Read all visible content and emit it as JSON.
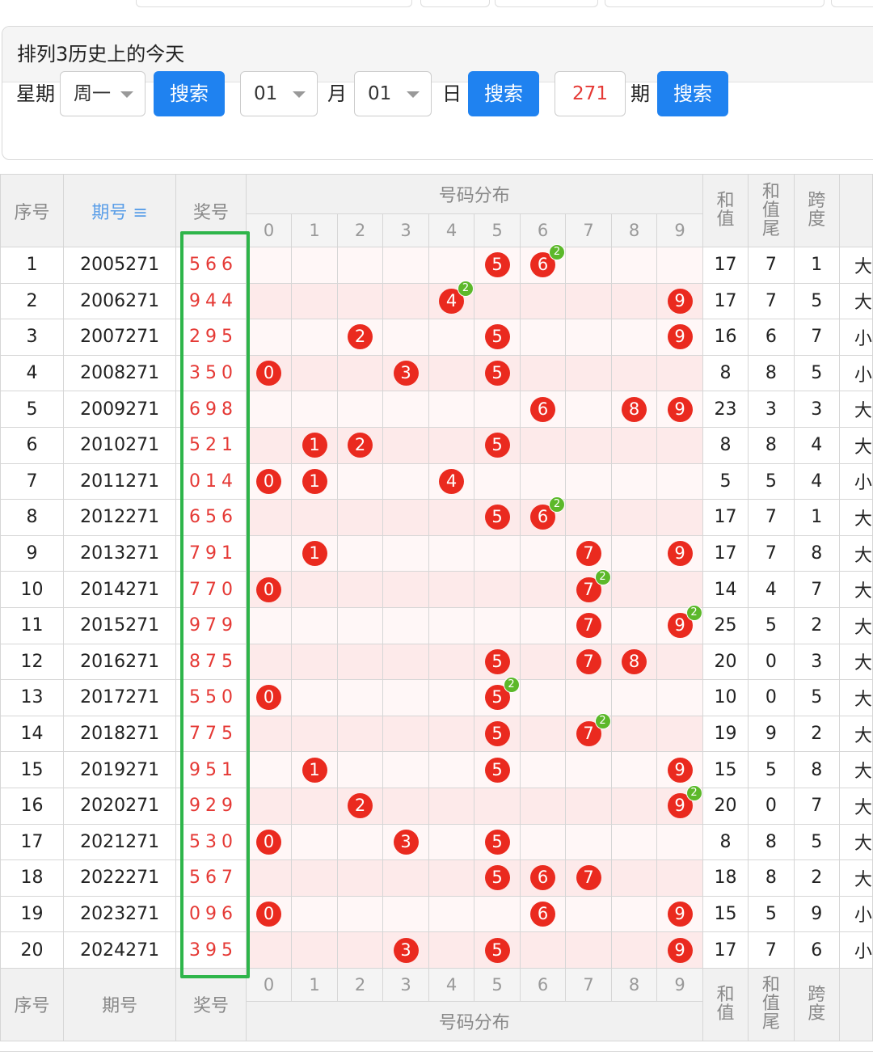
{
  "panel": {
    "title": "排列3历史上的今天",
    "weekday_label": "星期",
    "weekday_value": "周一",
    "search_label": "搜索",
    "month_value": "01",
    "month_label": "月",
    "day_value": "01",
    "day_label": "日",
    "issue_value": "271",
    "issue_label": "期"
  },
  "table": {
    "headers": {
      "index": "序号",
      "issue": "期号",
      "issue_sort_icon": "≡",
      "award": "奖号",
      "dist": "号码分布",
      "sum": "和值",
      "sum_tail": "和值尾",
      "span": "跨度"
    },
    "digits": [
      "0",
      "1",
      "2",
      "3",
      "4",
      "5",
      "6",
      "7",
      "8",
      "9"
    ],
    "rows": [
      {
        "idx": "1",
        "issue": "2005271",
        "award": "566",
        "sum": "17",
        "tail": "7",
        "span": "1",
        "size": "大"
      },
      {
        "idx": "2",
        "issue": "2006271",
        "award": "944",
        "sum": "17",
        "tail": "7",
        "span": "5",
        "size": "大"
      },
      {
        "idx": "3",
        "issue": "2007271",
        "award": "295",
        "sum": "16",
        "tail": "6",
        "span": "7",
        "size": "小"
      },
      {
        "idx": "4",
        "issue": "2008271",
        "award": "350",
        "sum": "8",
        "tail": "8",
        "span": "5",
        "size": "小"
      },
      {
        "idx": "5",
        "issue": "2009271",
        "award": "698",
        "sum": "23",
        "tail": "3",
        "span": "3",
        "size": "大"
      },
      {
        "idx": "6",
        "issue": "2010271",
        "award": "521",
        "sum": "8",
        "tail": "8",
        "span": "4",
        "size": "大"
      },
      {
        "idx": "7",
        "issue": "2011271",
        "award": "014",
        "sum": "5",
        "tail": "5",
        "span": "4",
        "size": "小"
      },
      {
        "idx": "8",
        "issue": "2012271",
        "award": "656",
        "sum": "17",
        "tail": "7",
        "span": "1",
        "size": "大"
      },
      {
        "idx": "9",
        "issue": "2013271",
        "award": "791",
        "sum": "17",
        "tail": "7",
        "span": "8",
        "size": "大"
      },
      {
        "idx": "10",
        "issue": "2014271",
        "award": "770",
        "sum": "14",
        "tail": "4",
        "span": "7",
        "size": "大"
      },
      {
        "idx": "11",
        "issue": "2015271",
        "award": "979",
        "sum": "25",
        "tail": "5",
        "span": "2",
        "size": "大"
      },
      {
        "idx": "12",
        "issue": "2016271",
        "award": "875",
        "sum": "20",
        "tail": "0",
        "span": "3",
        "size": "大"
      },
      {
        "idx": "13",
        "issue": "2017271",
        "award": "550",
        "sum": "10",
        "tail": "0",
        "span": "5",
        "size": "大"
      },
      {
        "idx": "14",
        "issue": "2018271",
        "award": "775",
        "sum": "19",
        "tail": "9",
        "span": "2",
        "size": "大"
      },
      {
        "idx": "15",
        "issue": "2019271",
        "award": "951",
        "sum": "15",
        "tail": "5",
        "span": "8",
        "size": "大"
      },
      {
        "idx": "16",
        "issue": "2020271",
        "award": "929",
        "sum": "20",
        "tail": "0",
        "span": "7",
        "size": "大"
      },
      {
        "idx": "17",
        "issue": "2021271",
        "award": "530",
        "sum": "8",
        "tail": "8",
        "span": "5",
        "size": "大"
      },
      {
        "idx": "18",
        "issue": "2022271",
        "award": "567",
        "sum": "18",
        "tail": "8",
        "span": "2",
        "size": "大"
      },
      {
        "idx": "19",
        "issue": "2023271",
        "award": "096",
        "sum": "15",
        "tail": "5",
        "span": "9",
        "size": "小"
      },
      {
        "idx": "20",
        "issue": "2024271",
        "award": "395",
        "sum": "17",
        "tail": "7",
        "span": "6",
        "size": "小"
      }
    ],
    "repeat_badge": "2",
    "highlight_color": "#2eb54a",
    "ball_color": "#ea2a1f",
    "badge_color": "#5cb82a"
  }
}
